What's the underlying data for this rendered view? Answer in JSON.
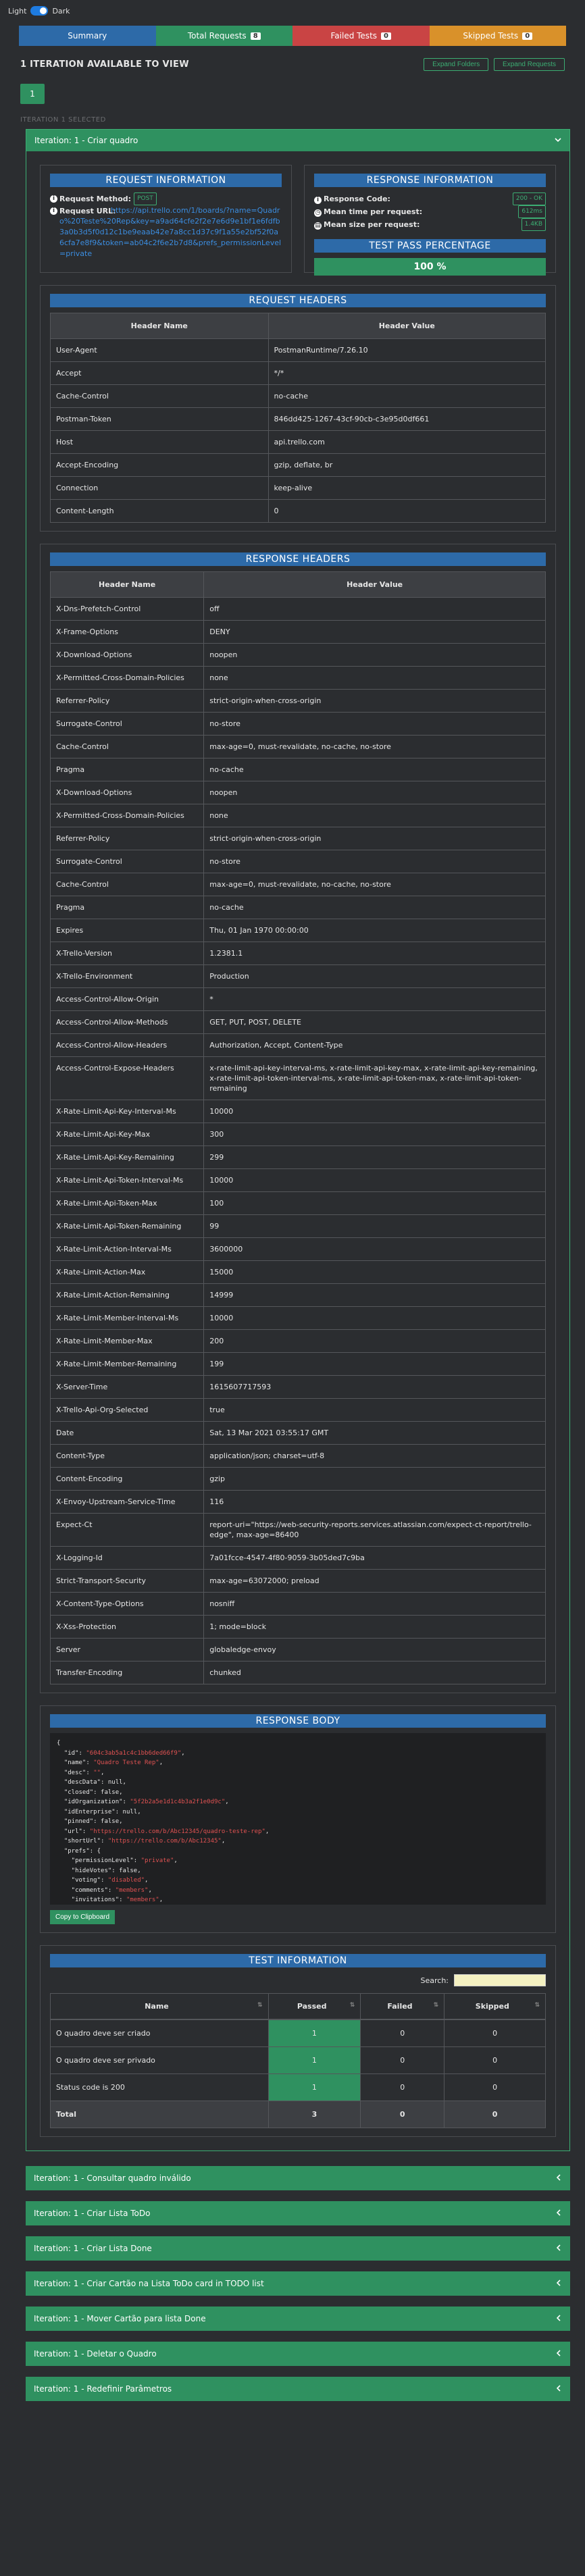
{
  "theme": {
    "light_label": "Light",
    "dark_label": "Dark"
  },
  "tabs": [
    {
      "label": "Summary",
      "badge": "",
      "color": "#2d6aa8"
    },
    {
      "label": "Total Requests",
      "badge": "8",
      "color": "#2f9160"
    },
    {
      "label": "Failed Tests",
      "badge": "0",
      "color": "#c94444"
    },
    {
      "label": "Skipped Tests",
      "badge": "0",
      "color": "#d9912a"
    }
  ],
  "iterations_header": {
    "title": "1 ITERATION AVAILABLE TO VIEW",
    "expand_label": "Expand Folders",
    "collapse_label": "Expand Requests"
  },
  "iteration_number": "1",
  "iteration_selected": "ITERATION 1 SELECTED",
  "main_panel": {
    "title": "Iteration: 1 - Criar quadro"
  },
  "request_info": {
    "title": "REQUEST INFORMATION",
    "method_label": "Request Method:",
    "method": "POST",
    "url_label": "Request URL:",
    "url": "https://api.trello.com/1/boards/?name=Quadro%20Teste%20Rep&key=a9ad64cfe2f2e7e6d9e1bf1e6fdfb3a0b3d5f0d12c1be9eaab42e7a8cc1d37c9f1a55e2bf52f0a6cfa7e8f9&token=ab04c2f6e2b7d8&prefs_permissionLevel=private"
  },
  "response_info": {
    "title": "RESPONSE INFORMATION",
    "code_label": "Response Code:",
    "code": "200 - OK",
    "mean_time_label": "Mean time per request:",
    "mean_time": "612ms",
    "mean_size_label": "Mean size per request:",
    "mean_size": "1.4KB",
    "pass_title": "TEST PASS PERCENTAGE",
    "pass_value": "100 %"
  },
  "request_headers": {
    "title": "REQUEST HEADERS",
    "col_name": "Header Name",
    "col_value": "Header Value",
    "rows": [
      [
        "User-Agent",
        "PostmanRuntime/7.26.10"
      ],
      [
        "Accept",
        "*/*"
      ],
      [
        "Cache-Control",
        "no-cache"
      ],
      [
        "Postman-Token",
        "846dd425-1267-43cf-90cb-c3e95d0df661"
      ],
      [
        "Host",
        "api.trello.com"
      ],
      [
        "Accept-Encoding",
        "gzip, deflate, br"
      ],
      [
        "Connection",
        "keep-alive"
      ],
      [
        "Content-Length",
        "0"
      ]
    ]
  },
  "response_headers": {
    "title": "RESPONSE HEADERS",
    "col_name": "Header Name",
    "col_value": "Header Value",
    "rows": [
      [
        "X-Dns-Prefetch-Control",
        "off"
      ],
      [
        "X-Frame-Options",
        "DENY"
      ],
      [
        "X-Download-Options",
        "noopen"
      ],
      [
        "X-Permitted-Cross-Domain-Policies",
        "none"
      ],
      [
        "Referrer-Policy",
        "strict-origin-when-cross-origin"
      ],
      [
        "Surrogate-Control",
        "no-store"
      ],
      [
        "Cache-Control",
        "max-age=0, must-revalidate, no-cache, no-store"
      ],
      [
        "Pragma",
        "no-cache"
      ],
      [
        "X-Download-Options",
        "noopen"
      ],
      [
        "X-Permitted-Cross-Domain-Policies",
        "none"
      ],
      [
        "Referrer-Policy",
        "strict-origin-when-cross-origin"
      ],
      [
        "Surrogate-Control",
        "no-store"
      ],
      [
        "Cache-Control",
        "max-age=0, must-revalidate, no-cache, no-store"
      ],
      [
        "Pragma",
        "no-cache"
      ],
      [
        "Expires",
        "Thu, 01 Jan 1970 00:00:00"
      ],
      [
        "X-Trello-Version",
        "1.2381.1"
      ],
      [
        "X-Trello-Environment",
        "Production"
      ],
      [
        "Access-Control-Allow-Origin",
        "*"
      ],
      [
        "Access-Control-Allow-Methods",
        "GET, PUT, POST, DELETE"
      ],
      [
        "Access-Control-Allow-Headers",
        "Authorization, Accept, Content-Type"
      ],
      [
        "Access-Control-Expose-Headers",
        "x-rate-limit-api-key-interval-ms, x-rate-limit-api-key-max, x-rate-limit-api-key-remaining, x-rate-limit-api-token-interval-ms, x-rate-limit-api-token-max, x-rate-limit-api-token-remaining"
      ],
      [
        "X-Rate-Limit-Api-Key-Interval-Ms",
        "10000"
      ],
      [
        "X-Rate-Limit-Api-Key-Max",
        "300"
      ],
      [
        "X-Rate-Limit-Api-Key-Remaining",
        "299"
      ],
      [
        "X-Rate-Limit-Api-Token-Interval-Ms",
        "10000"
      ],
      [
        "X-Rate-Limit-Api-Token-Max",
        "100"
      ],
      [
        "X-Rate-Limit-Api-Token-Remaining",
        "99"
      ],
      [
        "X-Rate-Limit-Action-Interval-Ms",
        "3600000"
      ],
      [
        "X-Rate-Limit-Action-Max",
        "15000"
      ],
      [
        "X-Rate-Limit-Action-Remaining",
        "14999"
      ],
      [
        "X-Rate-Limit-Member-Interval-Ms",
        "10000"
      ],
      [
        "X-Rate-Limit-Member-Max",
        "200"
      ],
      [
        "X-Rate-Limit-Member-Remaining",
        "199"
      ],
      [
        "X-Server-Time",
        "1615607717593"
      ],
      [
        "X-Trello-Api-Org-Selected",
        "true"
      ],
      [
        "Date",
        "Sat, 13 Mar 2021 03:55:17 GMT"
      ],
      [
        "Content-Type",
        "application/json; charset=utf-8"
      ],
      [
        "Content-Encoding",
        "gzip"
      ],
      [
        "X-Envoy-Upstream-Service-Time",
        "116"
      ],
      [
        "Expect-Ct",
        "report-uri=\"https://web-security-reports.services.atlassian.com/expect-ct-report/trello-edge\", max-age=86400"
      ],
      [
        "X-Logging-Id",
        "7a01fcce-4547-4f80-9059-3b05ded7c9ba"
      ],
      [
        "Strict-Transport-Security",
        "max-age=63072000; preload"
      ],
      [
        "X-Content-Type-Options",
        "nosniff"
      ],
      [
        "X-Xss-Protection",
        "1; mode=block"
      ],
      [
        "Server",
        "globaledge-envoy"
      ],
      [
        "Transfer-Encoding",
        "chunked"
      ]
    ]
  },
  "response_body": {
    "title": "RESPONSE BODY",
    "lines": [
      {
        "t": "{"
      },
      {
        "k": "  \"id\": ",
        "v": "\"604c3ab5a1c4c1bb6ded66f9\"",
        "e": ","
      },
      {
        "k": "  \"name\": ",
        "v": "\"Quadro Teste Rep\"",
        "e": ","
      },
      {
        "k": "  \"desc\": ",
        "v": "\"\"",
        "e": ","
      },
      {
        "k": "  \"descData\": null,"
      },
      {
        "k": "  \"closed\": false,"
      },
      {
        "k": "  \"idOrganization\": ",
        "v": "\"5f2b2a5e1d1c4b3a2f1e0d9c\"",
        "e": ","
      },
      {
        "k": "  \"idEnterprise\": null,"
      },
      {
        "k": "  \"pinned\": false,"
      },
      {
        "k": "  \"url\": ",
        "v": "\"https://trello.com/b/Abc12345/quadro-teste-rep\"",
        "e": ","
      },
      {
        "k": "  \"shortUrl\": ",
        "v": "\"https://trello.com/b/Abc12345\"",
        "e": ","
      },
      {
        "k": "  \"prefs\": {"
      },
      {
        "k": "    \"permissionLevel\": ",
        "v": "\"private\"",
        "e": ","
      },
      {
        "k": "    \"hideVotes\": false,"
      },
      {
        "k": "    \"voting\": ",
        "v": "\"disabled\"",
        "e": ","
      },
      {
        "k": "    \"comments\": ",
        "v": "\"members\"",
        "e": ","
      },
      {
        "k": "    \"invitations\": ",
        "v": "\"members\"",
        "e": ","
      }
    ],
    "copy_label": "Copy to Clipboard"
  },
  "test_info": {
    "title": "TEST INFORMATION",
    "search_label": "Search:",
    "cols": [
      "Name",
      "Passed",
      "Failed",
      "Skipped"
    ],
    "rows": [
      [
        "O quadro deve ser criado",
        "1",
        "0",
        "0"
      ],
      [
        "O quadro deve ser privado",
        "1",
        "0",
        "0"
      ],
      [
        "Status code is 200",
        "1",
        "0",
        "0"
      ]
    ],
    "total": [
      "Total",
      "3",
      "0",
      "0"
    ]
  },
  "collapsed_iterations": [
    "Iteration: 1 - Consultar quadro inválido",
    "Iteration: 1 - Criar Lista ToDo",
    "Iteration: 1 - Criar Lista Done",
    "Iteration: 1 - Criar Cartão na Lista ToDo card in TODO list",
    "Iteration: 1 - Mover Cartão para lista Done",
    "Iteration: 1 - Deletar o Quadro",
    "Iteration: 1 - Redefinir Parâmetros"
  ]
}
